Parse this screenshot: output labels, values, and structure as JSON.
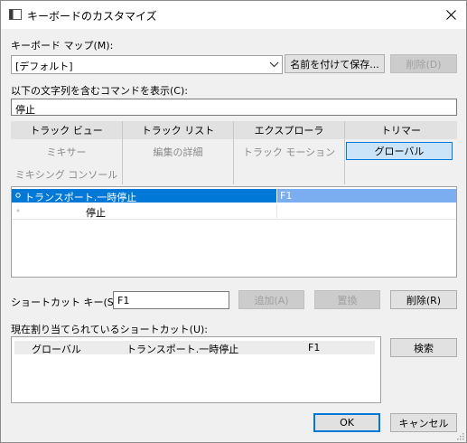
{
  "window": {
    "title": "キーボードのカスタマイズ"
  },
  "keyboard_map": {
    "label": "キーボード マップ(M):",
    "selected": "[デフォルト]",
    "save_as_label": "名前を付けて保存...",
    "delete_label": "削除(D)"
  },
  "filter": {
    "label": "以下の文字列を含むコマンドを表示(C):",
    "value": "停止"
  },
  "categories": {
    "row1": [
      "トラック ビュー",
      "トラック リスト",
      "エクスプローラ",
      "トリマー"
    ],
    "row2": [
      "ミキサー",
      "編集の詳細",
      "トラック モーション",
      "グローバル"
    ],
    "row3": [
      "ミキシング コンソール"
    ]
  },
  "commands": [
    {
      "name": "トランスポート.一時停止",
      "key": "F1"
    },
    {
      "name": "停止",
      "key": ""
    }
  ],
  "shortcut": {
    "label": "ショートカット キー(S):",
    "value": "F1",
    "add_label": "追加(A)",
    "replace_label": "置換",
    "delete_label": "削除(R)"
  },
  "assigned": {
    "label": "現在割り当てられているショートカット(U):",
    "rows": [
      {
        "context": "グローバル",
        "command": "トランスポート.一時停止",
        "key": "F1"
      }
    ],
    "search_label": "検索"
  },
  "footer": {
    "ok_label": "OK",
    "cancel_label": "キャンセル"
  },
  "colors": {
    "accent": "#0078d7",
    "selected_row": "#0078d7",
    "selected_key_cell": "#7aaef0"
  }
}
